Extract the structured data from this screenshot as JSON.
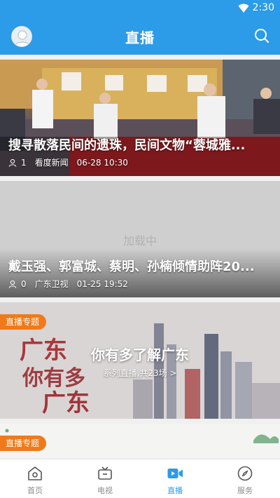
{
  "statusbar": {
    "time": "2:30",
    "wifi_icon": "wifi-icon"
  },
  "header": {
    "title": "直播",
    "avatar_icon": "avatar-icon",
    "search_icon": "search-icon",
    "color": "#2c9be8"
  },
  "cards": [
    {
      "title": "搜寻散落民间的遗珠，民间文物“蓉城雅...",
      "viewers": "1",
      "source": "看度新闻",
      "time": "06-28 10:30"
    },
    {
      "placeholder": "加载中",
      "title": "戴玉强、郭富城、蔡明、孙楠倾情助阵20...",
      "viewers": "0",
      "source": "广东卫视",
      "time": "01-25 19:52"
    },
    {
      "badge": "直播专题",
      "headline": "你有多了解广东",
      "subtitle": "系列直播,共23场 >"
    },
    {
      "badge": "直播专题"
    }
  ],
  "tabs": [
    {
      "label": "首页",
      "icon": "home-icon"
    },
    {
      "label": "电视",
      "icon": "tv-icon"
    },
    {
      "label": "直播",
      "icon": "live-video-icon",
      "active": true
    },
    {
      "label": "服务",
      "icon": "compass-icon"
    }
  ],
  "colors": {
    "accent": "#2c9be8",
    "badge": "#f07a1a",
    "inactive": "#8a8a8a"
  }
}
